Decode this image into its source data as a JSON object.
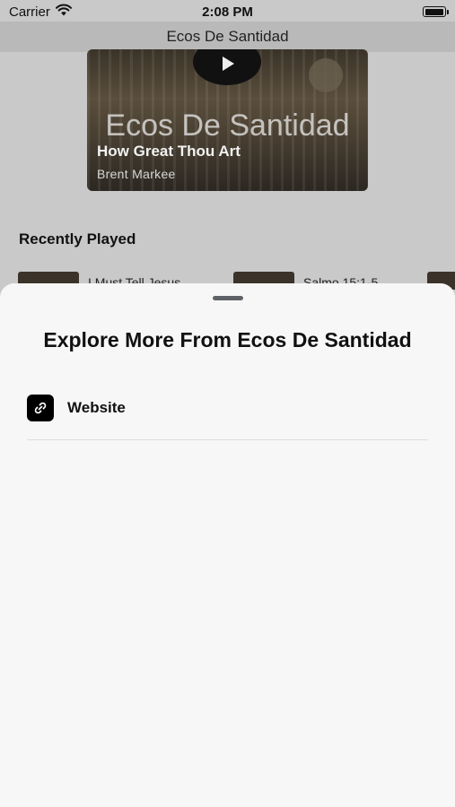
{
  "status_bar": {
    "carrier": "Carrier",
    "time": "2:08 PM"
  },
  "nav": {
    "title": "Ecos De Santidad"
  },
  "now_playing": {
    "brand_text": "Ecos De Santidad",
    "title": "How Great Thou Art",
    "artist": "Brent Markee"
  },
  "recently_played": {
    "heading": "Recently Played",
    "items": [
      {
        "label": "I Must Tell Jesus"
      },
      {
        "label": "Salmo 15:1-5"
      }
    ]
  },
  "sheet": {
    "title": "Explore More From Ecos De Santidad",
    "links": [
      {
        "label": "Website",
        "icon": "link-icon"
      }
    ]
  },
  "colors": {
    "sheet_background": "#f7f7f7",
    "icon_background": "#000000"
  }
}
